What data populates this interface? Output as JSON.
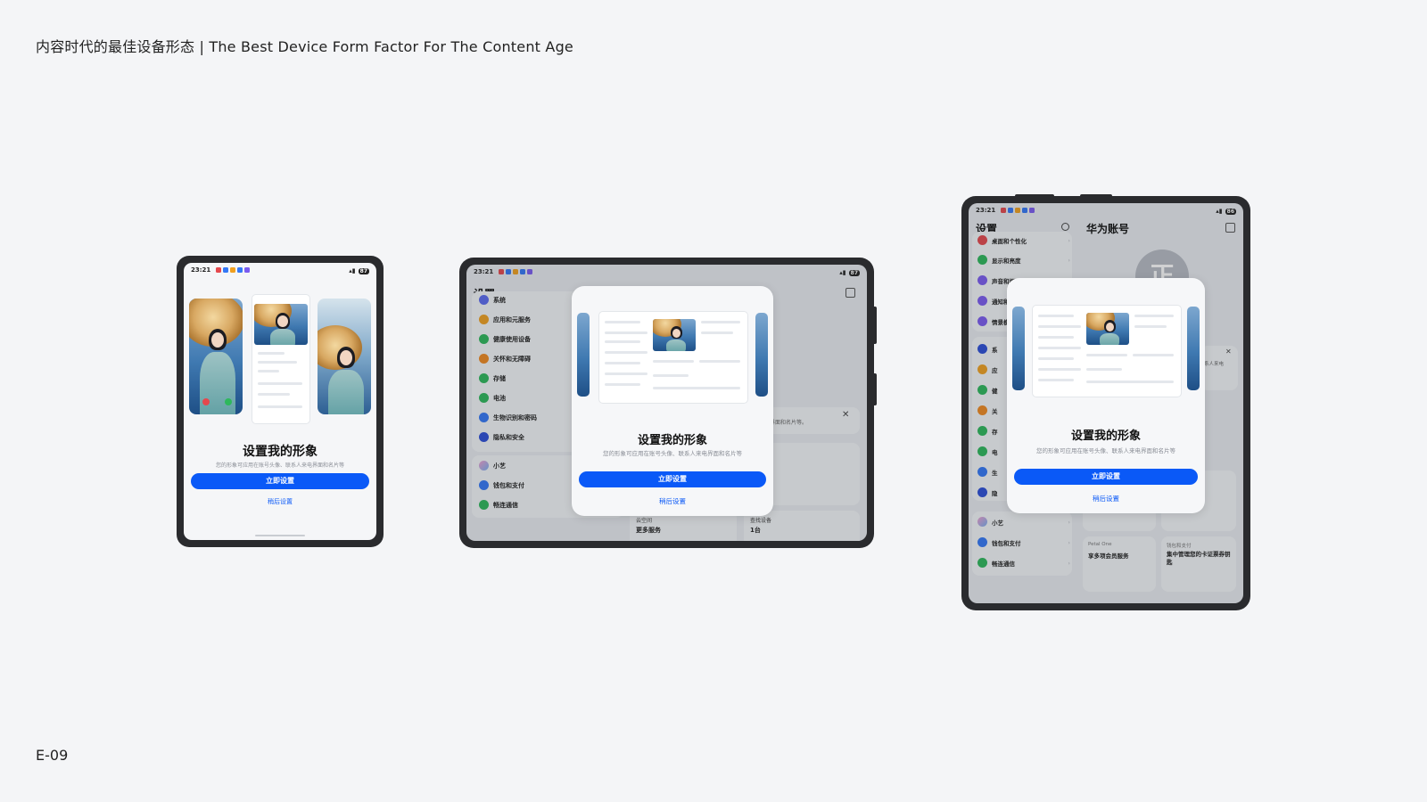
{
  "header": {
    "title": "内容时代的最佳设备形态 | The Best Device Form Factor For The Content Age"
  },
  "footer": {
    "page_code": "E-09"
  },
  "status_time": "23:21",
  "battery": {
    "small": "87",
    "mid": "87",
    "large": "86"
  },
  "dialog": {
    "title": "设置我的形象",
    "description": "您的形象可应用在账号头像、联系人来电界面和名片等",
    "primary_button": "立即设置",
    "secondary_button": "稍后设置"
  },
  "settings": {
    "title": "设置",
    "account_title": "华为账号",
    "avatar_letter": "正",
    "items_mid": [
      "系统",
      "应用和元服务",
      "健康使用设备",
      "关怀和无障碍",
      "存储",
      "电池",
      "生物识别和密码",
      "隐私和安全"
    ],
    "items_mid_2": [
      "小艺",
      "钱包和支付",
      "畅连通信"
    ],
    "items_large_top": [
      "桌面和个性化",
      "显示和亮度",
      "声音和振动",
      "通知和状态栏",
      "情景模式"
    ],
    "items_large_short": [
      "系",
      "应",
      "健",
      "关",
      "存",
      "电",
      "生",
      "隐"
    ],
    "items_large_2": [
      "小艺",
      "钱包和支付",
      "畅连通信"
    ],
    "cards_mid": [
      "云空间",
      "查找设备"
    ],
    "cards_mid_sub": [
      "更多服务",
      "1台"
    ],
    "card_petal_label": "Petal One",
    "card_petal_text": "享多项会员服务",
    "card_wallet_label": "钱包和支付",
    "card_wallet_text": "集中管理您的卡证票券钥匙",
    "notice_text": "来电界面和名片等。",
    "notice_text_large": "系人来电"
  },
  "icon_colors": [
    "#e5484d",
    "#3478f6",
    "#2eb85c",
    "#f0a020",
    "#7b5cf0",
    "#15a0c8"
  ]
}
